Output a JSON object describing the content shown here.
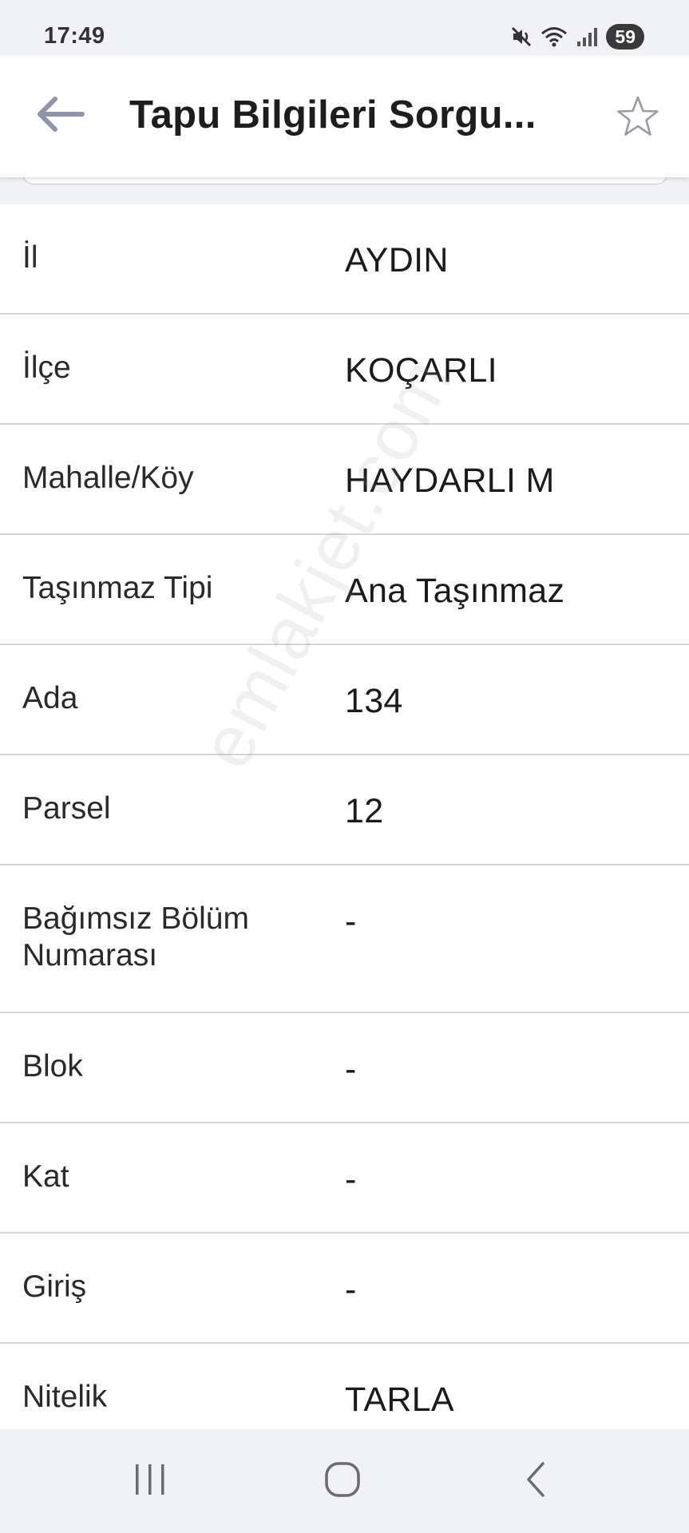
{
  "status_bar": {
    "time": "17:49",
    "battery": "59",
    "icons": [
      "mute-icon",
      "wifi-icon",
      "signal-icon"
    ]
  },
  "app_bar": {
    "title": "Tapu Bilgileri Sorgu...",
    "back_icon": "arrow-left-icon",
    "favorite_icon": "star-outline-icon"
  },
  "rows": [
    {
      "label": "İl",
      "value": "AYDIN"
    },
    {
      "label": "İlçe",
      "value": "KOÇARLI"
    },
    {
      "label": "Mahalle/Köy",
      "value": "HAYDARLI M"
    },
    {
      "label": "Taşınmaz Tipi",
      "value": "Ana Taşınmaz"
    },
    {
      "label": "Ada",
      "value": "134"
    },
    {
      "label": "Parsel",
      "value": "12"
    },
    {
      "label": "Bağımsız Bölüm Numarası",
      "value": "-"
    },
    {
      "label": "Blok",
      "value": "-"
    },
    {
      "label": "Kat",
      "value": "-"
    },
    {
      "label": "Giriş",
      "value": "-"
    },
    {
      "label": "Nitelik",
      "value": "TARLA"
    }
  ],
  "watermark": "emlakjet.com",
  "nav_bar": {
    "icons": [
      "recent-apps-icon",
      "home-icon",
      "back-icon"
    ]
  },
  "colors": {
    "background": "#f1f2f5",
    "surface": "#ffffff",
    "divider": "#d6d6d9",
    "icon_gray": "#9a9aa8"
  }
}
